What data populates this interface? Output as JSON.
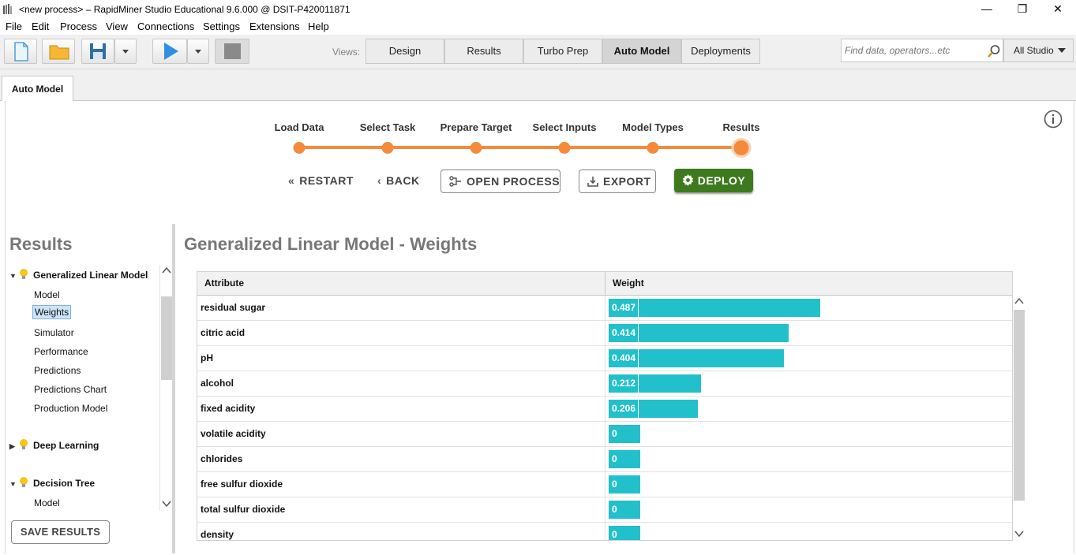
{
  "window": {
    "title": "<new process> – RapidMiner Studio Educational 9.6.000 @ DSIT-P420011871"
  },
  "menu": [
    "File",
    "Edit",
    "Process",
    "View",
    "Connections",
    "Settings",
    "Extensions",
    "Help"
  ],
  "toolbar": {
    "views_label": "Views:",
    "views": [
      "Design",
      "Results",
      "Turbo Prep",
      "Auto Model",
      "Deployments"
    ],
    "active_view": "Auto Model",
    "search_placeholder": "Find data, operators...etc",
    "scope": "All Studio"
  },
  "tab": {
    "label": "Auto Model"
  },
  "wizard": {
    "steps": [
      "Load Data",
      "Select Task",
      "Prepare Target",
      "Select Inputs",
      "Model Types",
      "Results"
    ],
    "current_step": "Results",
    "buttons": {
      "restart": "RESTART",
      "back": "BACK",
      "open_process": "OPEN PROCESS",
      "export": "EXPORT",
      "deploy": "DEPLOY"
    }
  },
  "sidebar": {
    "heading": "Results",
    "groups": [
      {
        "name": "Generalized Linear Model",
        "expanded": true,
        "items": [
          "Model",
          "Weights",
          "Simulator",
          "Performance",
          "Predictions",
          "Predictions Chart",
          "Production Model"
        ],
        "selected": "Weights"
      },
      {
        "name": "Deep Learning",
        "expanded": false,
        "items": []
      },
      {
        "name": "Decision Tree",
        "expanded": true,
        "items": [
          "Model"
        ]
      }
    ],
    "save_button": "SAVE RESULTS"
  },
  "main": {
    "title": "Generalized Linear Model - Weights",
    "columns": [
      "Attribute",
      "Weight"
    ],
    "max_weight": 0.487,
    "rows": [
      {
        "attribute": "residual sugar",
        "weight": "0.487",
        "value": 0.487
      },
      {
        "attribute": "citric acid",
        "weight": "0.414",
        "value": 0.414
      },
      {
        "attribute": "pH",
        "weight": "0.404",
        "value": 0.404
      },
      {
        "attribute": "alcohol",
        "weight": "0.212",
        "value": 0.212
      },
      {
        "attribute": "fixed acidity",
        "weight": "0.206",
        "value": 0.206
      },
      {
        "attribute": "volatile acidity",
        "weight": "0",
        "value": 0
      },
      {
        "attribute": "chlorides",
        "weight": "0",
        "value": 0
      },
      {
        "attribute": "free sulfur dioxide",
        "weight": "0",
        "value": 0
      },
      {
        "attribute": "total sulfur dioxide",
        "weight": "0",
        "value": 0
      },
      {
        "attribute": "density",
        "weight": "0",
        "value": 0
      }
    ]
  },
  "colors": {
    "accent_orange": "#f58a3c",
    "bar": "#22c0cb",
    "deploy_green": "#3d7a1e"
  }
}
